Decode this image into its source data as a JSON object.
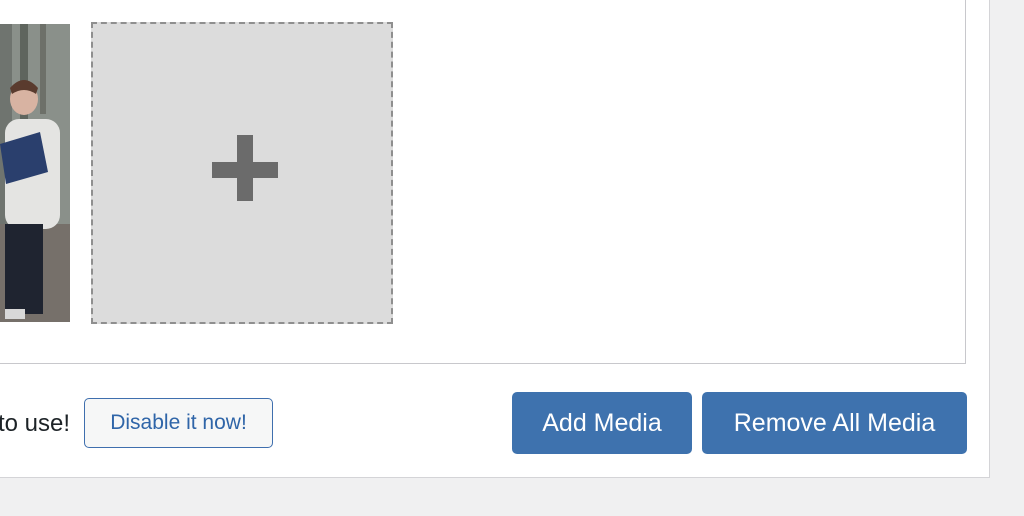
{
  "gallery": {
    "add_tile_icon": "plus-icon"
  },
  "notice": {
    "text": "to use!",
    "disable_button": "Disable it now!"
  },
  "actions": {
    "add_media": "Add Media",
    "remove_all_media": "Remove All Media"
  },
  "colors": {
    "primary_button": "#3e72ae",
    "secondary_border": "#3f6fae",
    "page_background": "#f0f0f1"
  }
}
